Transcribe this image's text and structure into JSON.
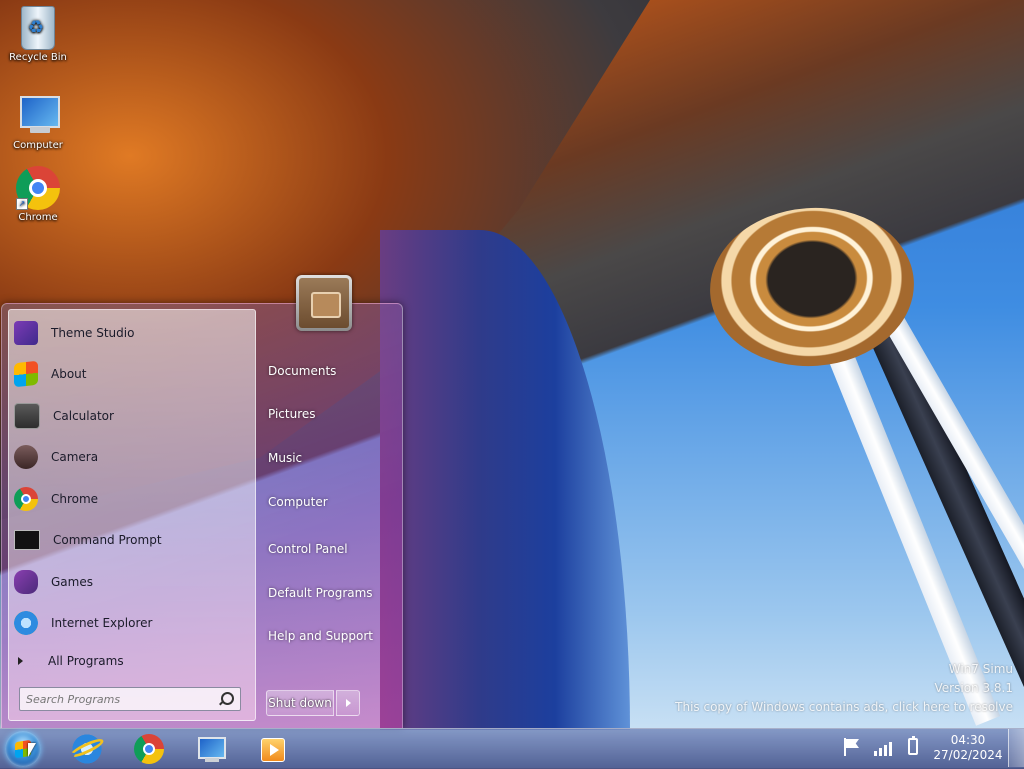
{
  "desktop": {
    "icons": [
      {
        "label": "Recycle Bin",
        "icon": "recycle-bin-icon"
      },
      {
        "label": "Computer",
        "icon": "computer-icon"
      },
      {
        "label": "Chrome",
        "icon": "chrome-icon"
      }
    ]
  },
  "start_menu": {
    "programs": [
      {
        "label": "Theme Studio",
        "icon": "theme-studio-icon"
      },
      {
        "label": "About",
        "icon": "windows-logo-icon"
      },
      {
        "label": "Calculator",
        "icon": "calculator-icon"
      },
      {
        "label": "Camera",
        "icon": "camera-icon"
      },
      {
        "label": "Chrome",
        "icon": "chrome-icon"
      },
      {
        "label": "Command Prompt",
        "icon": "command-prompt-icon"
      },
      {
        "label": "Games",
        "icon": "games-icon"
      },
      {
        "label": "Internet Explorer",
        "icon": "internet-explorer-icon"
      }
    ],
    "all_programs_label": "All Programs",
    "search_placeholder": "Search Programs",
    "right_links": [
      {
        "label": "Documents"
      },
      {
        "label": "Pictures"
      },
      {
        "label": "Music"
      },
      {
        "label": "Computer"
      },
      {
        "label": "Control Panel"
      },
      {
        "label": "Default Programs"
      },
      {
        "label": "Help and Support"
      }
    ],
    "shutdown_label": "Shut down"
  },
  "watermark": {
    "line1": "Win7 Simu",
    "line2": "Version 3.8.1",
    "line3": "This copy of Windows contains ads, click here to resolve"
  },
  "taskbar": {
    "pinned": [
      "internet-explorer-icon",
      "chrome-icon",
      "computer-icon",
      "media-player-icon"
    ],
    "clock_time": "04:30",
    "clock_date": "27/02/2024"
  },
  "colors": {
    "taskbar": "#4a5a8e",
    "start_menu_tint": "#a040a8",
    "sky": "#3f8de2"
  }
}
